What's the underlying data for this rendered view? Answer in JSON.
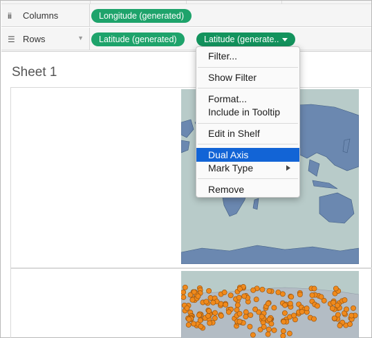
{
  "shelves": {
    "columns": {
      "label": "Columns",
      "icon": "columns-icon",
      "pills": [
        "Longitude (generated)"
      ]
    },
    "rows": {
      "label": "Rows",
      "icon": "rows-icon",
      "pills": [
        "Latitude (generated)",
        "Latitude (generate.."
      ]
    }
  },
  "sheet": {
    "title": "Sheet 1"
  },
  "context_menu": {
    "items": [
      {
        "label": "Filter..."
      },
      {
        "label": "Show Filter"
      },
      {
        "label": "Format..."
      },
      {
        "label": "Include in Tooltip"
      },
      {
        "label": "Edit in Shelf"
      },
      {
        "label": "Dual Axis",
        "highlighted": true
      },
      {
        "label": "Mark Type",
        "submenu": true
      },
      {
        "label": "Remove"
      }
    ]
  },
  "colors": {
    "pill": "#1ea36b",
    "pill_active": "#13935d",
    "menu_highlight": "#1264d6",
    "ocean": "#b8cbc9",
    "land": "#6b88b0",
    "marks": "#f08a1c"
  }
}
